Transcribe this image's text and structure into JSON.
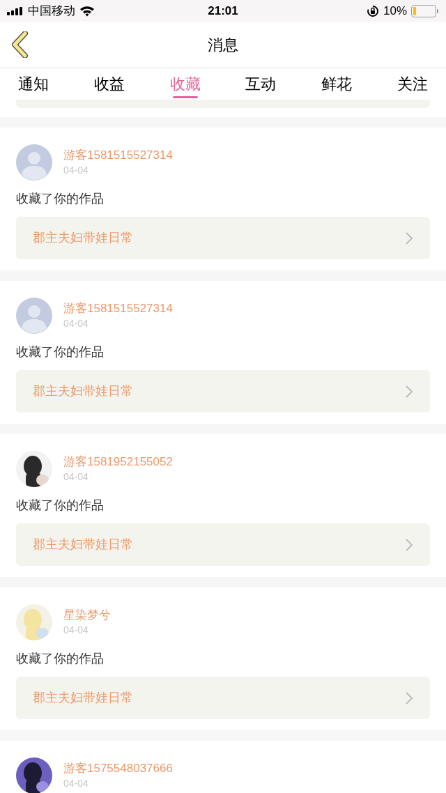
{
  "status_bar": {
    "carrier": "中国移动",
    "time": "21:01",
    "battery": "10%"
  },
  "header": {
    "title": "消息"
  },
  "tabs": [
    {
      "label": "通知",
      "selected": false
    },
    {
      "label": "收益",
      "selected": false
    },
    {
      "label": "收藏",
      "selected": true
    },
    {
      "label": "互动",
      "selected": false
    },
    {
      "label": "鲜花",
      "selected": false
    },
    {
      "label": "关注",
      "selected": false
    }
  ],
  "messages": [
    {
      "avatar": {
        "kind": "default"
      },
      "name": "游客1581515527314",
      "date": "04-04",
      "text": "收藏了你的作品",
      "work": "郡主夫妇带娃日常"
    },
    {
      "avatar": {
        "kind": "default"
      },
      "name": "游客1581515527314",
      "date": "04-04",
      "text": "收藏了你的作品",
      "work": "郡主夫妇带娃日常"
    },
    {
      "name": "游客1581952155052",
      "date": "04-04",
      "text": "收藏了你的作品",
      "work": "郡主夫妇带娃日常"
    },
    {
      "name": "星染梦兮",
      "date": "04-04",
      "text": "收藏了你的作品",
      "work": "郡主夫妇带娃日常"
    },
    {
      "name": "游客1575548037666",
      "date": "04-04"
    }
  ]
}
